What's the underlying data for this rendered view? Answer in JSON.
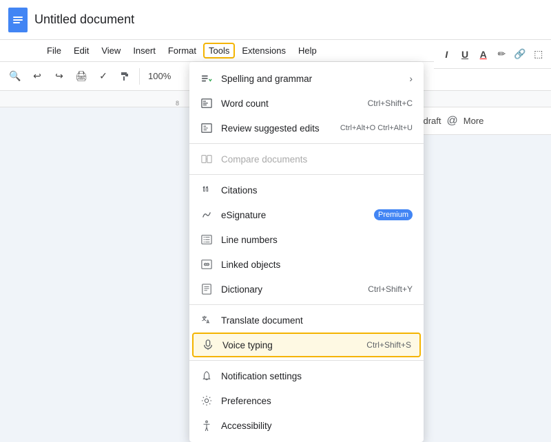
{
  "document": {
    "title": "Untitled document",
    "icon_char": "≡"
  },
  "menu_bar": {
    "items": [
      {
        "id": "file",
        "label": "File"
      },
      {
        "id": "edit",
        "label": "Edit"
      },
      {
        "id": "view",
        "label": "View"
      },
      {
        "id": "insert",
        "label": "Insert"
      },
      {
        "id": "format",
        "label": "Format"
      },
      {
        "id": "tools",
        "label": "Tools",
        "active": true
      },
      {
        "id": "extensions",
        "label": "Extensions"
      },
      {
        "id": "help",
        "label": "Help"
      }
    ]
  },
  "toolbar": {
    "zoom": "100%"
  },
  "right_toolbar": {
    "icons": [
      "I",
      "U",
      "A",
      "✏",
      "🔗",
      "⬚"
    ]
  },
  "draft_bar": {
    "draft_label": "l draft",
    "more_label": "More",
    "at_symbol": "@"
  },
  "tools_menu": {
    "items": [
      {
        "id": "spelling-grammar",
        "icon": "abc_check",
        "label": "Spelling and grammar",
        "shortcut": "",
        "has_arrow": true,
        "disabled": false,
        "premium": false
      },
      {
        "id": "word-count",
        "icon": "grid",
        "label": "Word count",
        "shortcut": "Ctrl+Shift+C",
        "has_arrow": false,
        "disabled": false,
        "premium": false
      },
      {
        "id": "review-edits",
        "icon": "grid2",
        "label": "Review suggested edits",
        "shortcut": "Ctrl+Alt+O Ctrl+Alt+U",
        "has_arrow": false,
        "disabled": false,
        "premium": false
      },
      {
        "id": "compare-documents",
        "icon": "compare",
        "label": "Compare documents",
        "shortcut": "",
        "has_arrow": false,
        "disabled": true,
        "premium": false
      },
      {
        "id": "citations",
        "icon": "quote",
        "label": "Citations",
        "shortcut": "",
        "has_arrow": false,
        "disabled": false,
        "premium": false
      },
      {
        "id": "esignature",
        "icon": "esign",
        "label": "eSignature",
        "shortcut": "",
        "has_arrow": false,
        "disabled": false,
        "premium": true,
        "premium_label": "Premium"
      },
      {
        "id": "line-numbers",
        "icon": "lines",
        "label": "Line numbers",
        "shortcut": "",
        "has_arrow": false,
        "disabled": false,
        "premium": false
      },
      {
        "id": "linked-objects",
        "icon": "linked",
        "label": "Linked objects",
        "shortcut": "",
        "has_arrow": false,
        "disabled": false,
        "premium": false
      },
      {
        "id": "dictionary",
        "icon": "dict",
        "label": "Dictionary",
        "shortcut": "Ctrl+Shift+Y",
        "has_arrow": false,
        "disabled": false,
        "premium": false
      },
      {
        "id": "translate",
        "icon": "translate",
        "label": "Translate document",
        "shortcut": "",
        "has_arrow": false,
        "disabled": false,
        "premium": false
      },
      {
        "id": "voice-typing",
        "icon": "mic",
        "label": "Voice typing",
        "shortcut": "Ctrl+Shift+S",
        "has_arrow": false,
        "disabled": false,
        "premium": false,
        "highlighted": true
      },
      {
        "id": "notification-settings",
        "icon": "bell",
        "label": "Notification settings",
        "shortcut": "",
        "has_arrow": false,
        "disabled": false,
        "premium": false
      },
      {
        "id": "preferences",
        "icon": "prefs",
        "label": "Preferences",
        "shortcut": "",
        "has_arrow": false,
        "disabled": false,
        "premium": false
      },
      {
        "id": "accessibility",
        "icon": "access",
        "label": "Accessibility",
        "shortcut": "",
        "has_arrow": false,
        "disabled": false,
        "premium": false
      }
    ],
    "dividers_after": [
      "spelling-grammar",
      "compare-documents",
      "dictionary",
      "voice-typing",
      "notification-settings"
    ]
  }
}
